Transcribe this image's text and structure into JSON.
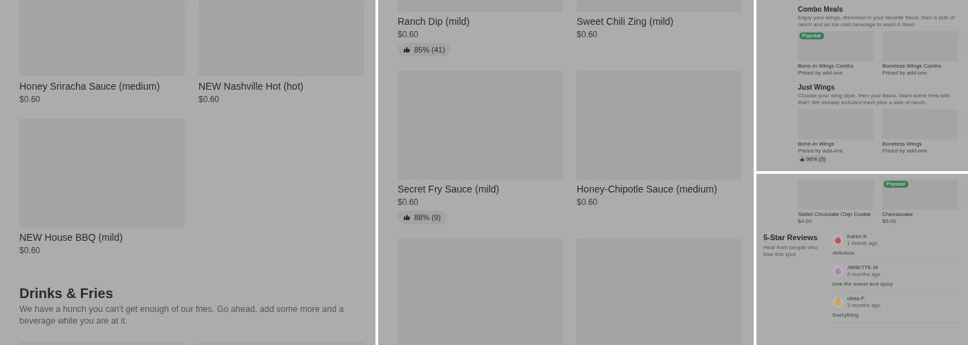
{
  "left_panel": {
    "items": [
      {
        "name": "Honey Sriracha Sauce (medium)",
        "price": "$0.60"
      },
      {
        "name": "NEW Nashville Hot (hot)",
        "price": "$0.60"
      },
      {
        "name": "NEW House BBQ (mild)",
        "price": "$0.60"
      }
    ],
    "section": {
      "title": "Drinks & Fries",
      "description": "We have a hunch you can't get enough of our fries. Go ahead, add some more and a beverage while you are at it."
    }
  },
  "middle_panel": {
    "items": [
      {
        "name": "Ranch Dip (mild)",
        "price": "$0.60",
        "rating": "85% (41)"
      },
      {
        "name": "Sweet Chili Zing (mild)",
        "price": "$0.60"
      },
      {
        "name": "Secret Fry Sauce (mild)",
        "price": "$0.60",
        "rating": "88% (9)"
      },
      {
        "name": "Honey-Chipotle Sauce (medium)",
        "price": "$0.60"
      }
    ]
  },
  "combo_panel": {
    "sections": [
      {
        "title": "Combo Meals",
        "description": "Enjoy your wings, drenched in your favorite flavor, then a side of ranch and an ice-cold beverage to wash it down",
        "items": [
          {
            "name": "Bone-In Wings Combo",
            "subtitle": "Priced by add-ons",
            "badge": "Popular"
          },
          {
            "name": "Boneless Wings Combo",
            "subtitle": "Priced by add-ons"
          }
        ]
      },
      {
        "title": "Just Wings",
        "description": "Choose your wing style, then your flavor. Want some fries with that? We already included them plus a side of ranch.",
        "items": [
          {
            "name": "Bone-In Wings",
            "subtitle": "Priced by add-ons",
            "rating": "96% (5)"
          },
          {
            "name": "Boneless Wings",
            "subtitle": "Priced by add-ons"
          }
        ]
      }
    ]
  },
  "reviews_panel": {
    "desserts": [
      {
        "name": "Skillet Chocolate Chip Cookie",
        "price": "$4.00"
      },
      {
        "name": "Cheesecake",
        "price": "$5.00",
        "badge": "Popular"
      }
    ],
    "title": "5-Star Reviews",
    "subtitle": "Hear from people who love this spot",
    "reviews": [
      {
        "name": "Karen K",
        "time": "1 month ago",
        "text": "delicious",
        "color": "#d24b4b"
      },
      {
        "name": "JANETTE M",
        "time": "4 months ago",
        "text": "love the sweet and spicy",
        "color": "#b77cc0"
      },
      {
        "name": "olivia F",
        "time": "3 months ago",
        "text": "Everything",
        "color": "#e0a13c"
      }
    ]
  }
}
